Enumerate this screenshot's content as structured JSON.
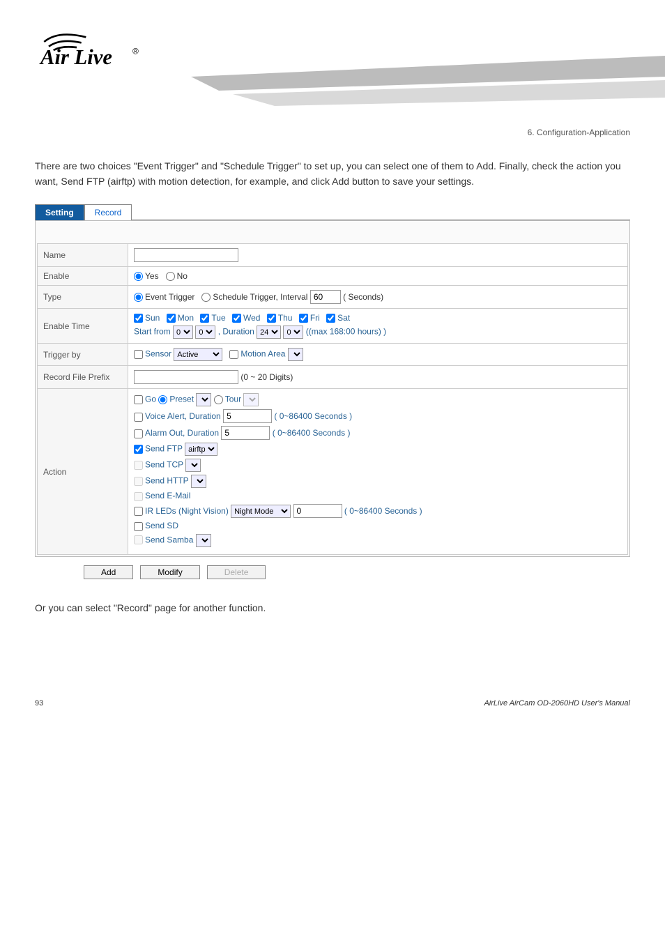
{
  "chapter_head": "6. Configuration-Application",
  "intro_text": "There are two choices \"Event Trigger\" and \"Schedule Trigger\" to set up, you can select one of them to Add. Finally, check the action you want, Send FTP (airftp) with motion detection, for example, and click Add button to save your settings.",
  "tabs": {
    "setting": "Setting",
    "record": "Record"
  },
  "rows": {
    "name": {
      "label": "Name",
      "value": ""
    },
    "enable": {
      "label": "Enable",
      "yes": "Yes",
      "no": "No"
    },
    "type": {
      "label": "Type",
      "event_trigger": "Event Trigger",
      "schedule_trigger": "Schedule Trigger, Interval",
      "interval_value": "60",
      "interval_unit": "( Seconds)"
    },
    "enable_time": {
      "label": "Enable Time",
      "days": {
        "sun": "Sun",
        "mon": "Mon",
        "tue": "Tue",
        "wed": "Wed",
        "thu": "Thu",
        "fri": "Fri",
        "sat": "Sat"
      },
      "start_from": "Start from",
      "start_h": "0",
      "start_m": "0",
      "duration": ", Duration",
      "dur_h": "24",
      "dur_m": "0",
      "max": "((max 168:00 hours) )"
    },
    "trigger": {
      "label": "Trigger by",
      "sensor": "Sensor",
      "sensor_mode": "Active",
      "motion": "Motion Area"
    },
    "prefix": {
      "label": "Record File Prefix",
      "value": "",
      "hint": "(0 ~ 20 Digits)"
    },
    "action": {
      "label": "Action",
      "go": "Go",
      "preset": "Preset",
      "tour": "Tour",
      "voice": "Voice Alert, Duration",
      "voice_val": "5",
      "voice_hint": "( 0~86400 Seconds )",
      "alarm": "Alarm Out, Duration",
      "alarm_val": "5",
      "alarm_hint": "( 0~86400 Seconds )",
      "ftp": "Send FTP",
      "ftp_opt": "airftp",
      "tcp": "Send TCP",
      "http": "Send HTTP",
      "email": "Send E-Mail",
      "ir": "IR LEDs (Night Vision)",
      "ir_mode": "Night Mode",
      "ir_val": "0",
      "ir_hint": "( 0~86400 Seconds )",
      "sd": "Send SD",
      "samba": "Send Samba"
    }
  },
  "buttons": {
    "add": "Add",
    "modify": "Modify",
    "delete": "Delete"
  },
  "postnote": "Or you can select \"Record\" page for another function.",
  "footer": {
    "page": "93",
    "manual": "AirLive AirCam OD-2060HD User's Manual"
  }
}
